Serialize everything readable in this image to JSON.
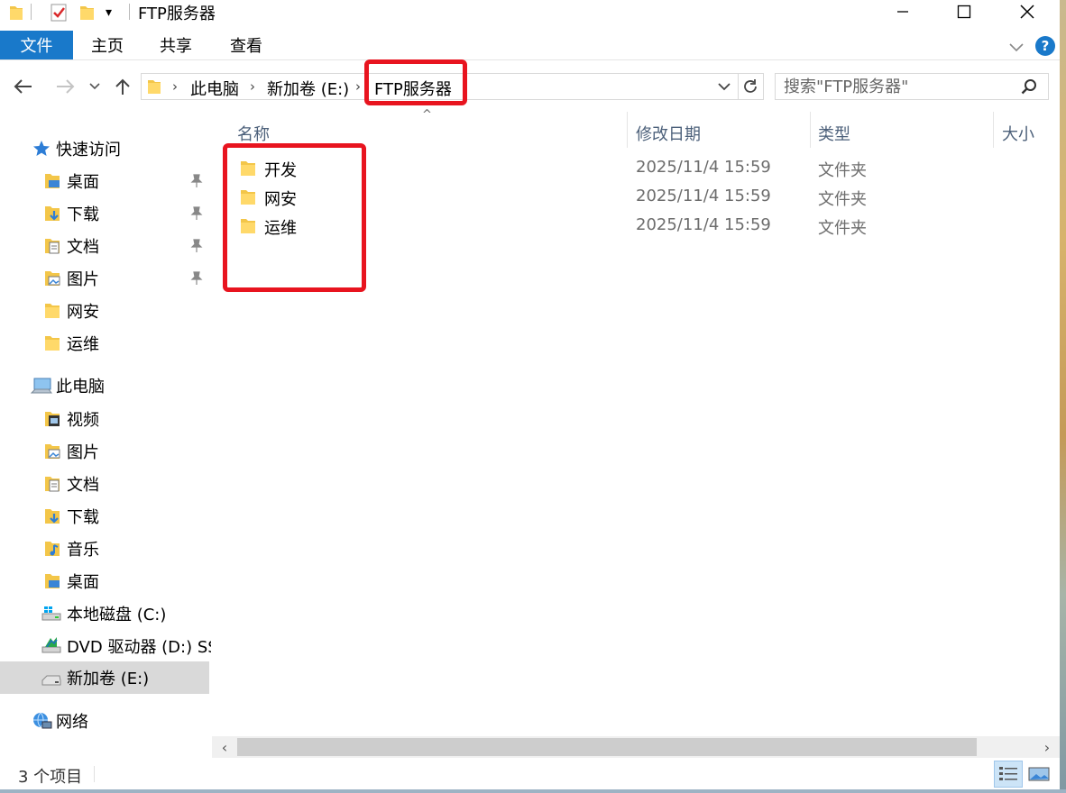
{
  "window": {
    "title": "FTP服务器",
    "min_symbol": "—",
    "max_symbol": "☐",
    "close_symbol": "✕"
  },
  "ribbon": {
    "tabs": [
      "文件",
      "主页",
      "共享",
      "查看"
    ],
    "help": "?"
  },
  "address": {
    "crumbs": [
      "此电脑",
      "新加卷 (E:)",
      "FTP服务器"
    ],
    "search_placeholder": "搜索\"FTP服务器\""
  },
  "nav": {
    "quick_access": "快速访问",
    "quick_items": [
      "桌面",
      "下载",
      "文档",
      "图片",
      "网安",
      "运维"
    ],
    "this_pc": "此电脑",
    "pc_items": [
      "视频",
      "图片",
      "文档",
      "下载",
      "音乐",
      "桌面",
      "本地磁盘 (C:)",
      "DVD 驱动器 (D:) SS",
      "新加卷 (E:)"
    ],
    "network": "网络",
    "selected": "新加卷 (E:)"
  },
  "columns": [
    "名称",
    "修改日期",
    "类型",
    "大小"
  ],
  "files": [
    {
      "name": "开发",
      "date": "2025/11/4 15:59",
      "type": "文件夹"
    },
    {
      "name": "网安",
      "date": "2025/11/4 15:59",
      "type": "文件夹"
    },
    {
      "name": "运维",
      "date": "2025/11/4 15:59",
      "type": "文件夹"
    }
  ],
  "status": {
    "count": "3 个项目"
  },
  "colors": {
    "accent": "#1979ca",
    "highlight_box": "#e8141f",
    "folder": "#f3c649"
  },
  "icons": [
    "folder-icon",
    "check-icon",
    "pin-icon",
    "star-icon",
    "pc-icon",
    "drive-icon",
    "network-icon",
    "search-icon",
    "refresh-icon"
  ]
}
